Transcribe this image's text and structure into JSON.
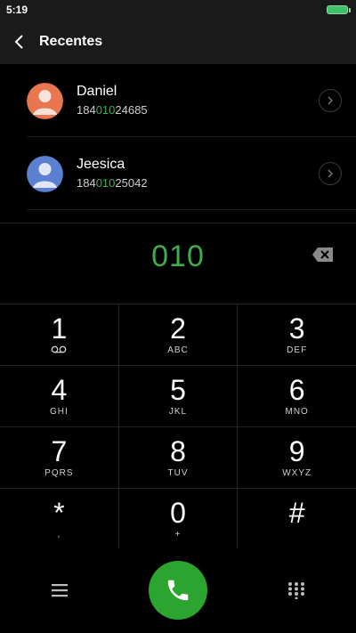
{
  "status": {
    "time": "5:19"
  },
  "header": {
    "title": "Recentes"
  },
  "contacts": [
    {
      "name": "Daniel",
      "number_prefix": "184",
      "number_match": "010",
      "number_suffix": "24685",
      "avatar_color": "#e8764f"
    },
    {
      "name": "Jeesica",
      "number_prefix": "184",
      "number_match": "010",
      "number_suffix": "25042",
      "avatar_color": "#5b7fd1"
    }
  ],
  "entry": {
    "digits": "010"
  },
  "keypad": [
    [
      {
        "main": "1",
        "sub": "voicemail-icon"
      },
      {
        "main": "2",
        "sub": "ABC"
      },
      {
        "main": "3",
        "sub": "DEF"
      }
    ],
    [
      {
        "main": "4",
        "sub": "GHI"
      },
      {
        "main": "5",
        "sub": "JKL"
      },
      {
        "main": "6",
        "sub": "MNO"
      }
    ],
    [
      {
        "main": "7",
        "sub": "PQRS"
      },
      {
        "main": "8",
        "sub": "TUV"
      },
      {
        "main": "9",
        "sub": "WXYZ"
      }
    ],
    [
      {
        "main": "*",
        "sub": ","
      },
      {
        "main": "0",
        "sub": "+"
      },
      {
        "main": "#",
        "sub": ""
      }
    ]
  ],
  "colors": {
    "accent_green": "#3fae49",
    "call_button": "#2ba52f"
  },
  "icons": {
    "back": "chevron-left-icon",
    "backspace": "backspace-icon",
    "menu": "menu-icon",
    "call": "phone-icon",
    "dialpad": "dialpad-icon"
  }
}
